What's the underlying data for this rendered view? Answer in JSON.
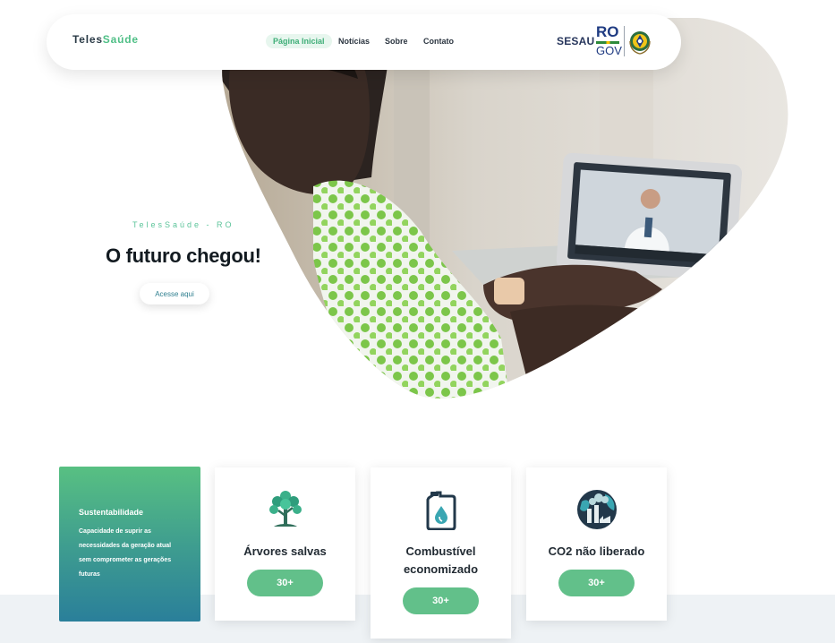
{
  "nav": {
    "brand_part1": "Teles",
    "brand_part2": "Saúde",
    "links": [
      "Página Inicial",
      "Notícias",
      "Sobre",
      "Contato"
    ],
    "logo_sesau": "SESAU",
    "logo_ro": "RO",
    "logo_gov": "GOV"
  },
  "hero": {
    "kicker": "TelesSaúde - RO",
    "title": "O futuro chegou!",
    "cta": "Acesse aqui"
  },
  "sustainability": {
    "title": "Sustentabilidade",
    "text": "Capacidade de suprir as necessidades da geração atual sem comprometer as gerações futuras"
  },
  "stats": [
    {
      "label": "Árvores salvas",
      "value": "30+",
      "icon": "tree-icon"
    },
    {
      "label": "Combustível economizado",
      "value": "30+",
      "icon": "fuel-can-icon"
    },
    {
      "label": "CO2 não liberado",
      "value": "30+",
      "icon": "factory-globe-icon"
    }
  ],
  "colors": {
    "accent_green": "#62c08a",
    "brand_dark": "#2a3a46",
    "gov_blue": "#1f3b82"
  }
}
